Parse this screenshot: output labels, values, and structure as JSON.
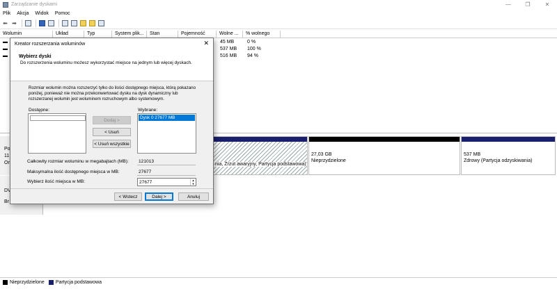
{
  "window": {
    "title": "Zarządzanie dyskami"
  },
  "menu": [
    "Plik",
    "Akcja",
    "Widok",
    "Pomoc"
  ],
  "volume_table": {
    "columns": [
      "Wolumin",
      "Układ",
      "Typ",
      "System plik...",
      "Stan",
      "Pojemność",
      "Wolne ...",
      "% wolnego"
    ],
    "rows": [
      {
        "free": "45 MB",
        "pct": "0 %"
      },
      {
        "free": "537 MB",
        "pct": "100 %"
      },
      {
        "free": "516 MB",
        "pct": "94 %"
      }
    ]
  },
  "disk_map": {
    "disk0_label_frag": [
      "Po",
      "11",
      "Or"
    ],
    "dvd_label_frag": [
      "DV",
      "Br"
    ],
    "partitions": [
      {
        "text": "nia, Zrzut awaryjny, Partycja podstawowa)"
      },
      {
        "size": "27,03 GB",
        "status": "Nieprzydzielone"
      },
      {
        "size": "537 MB",
        "status": "Zdrowy (Partycja odzyskiwania)"
      }
    ]
  },
  "legend": [
    {
      "label": "Nieprzydzielone",
      "color": "#000000"
    },
    {
      "label": "Partycja podstawowa",
      "color": "#1a1f6b"
    }
  ],
  "wizard": {
    "title": "Kreator rozszerzania woluminów",
    "heading": "Wybierz dyski",
    "subheading": "Do rozszerzenia woluminu możesz wykorzystać miejsce na jednym lub więcej dyskach.",
    "info": "Rozmiar wolumin można rozszerzyć tylko do ilości dostępnego miejsca, którą pokazano poniżej, ponieważ nie można przekonwertować dysku na dysk dynamiczny lub rozszerzanej wolumin jest woluminem rozruchowym albo systemowym.",
    "available_label": "Dostępne:",
    "selected_label": "Wybrane:",
    "selected_item": "Dysk 0     27677 MB",
    "add_button": "Dodaj >",
    "remove_button": "< Usuń",
    "remove_all_button": "< Usuń wszystkie",
    "total_label": "Całkowity rozmiar woluminu w megabajtach (MB):",
    "total_value": "121013",
    "max_label": "Maksymalna ilość dostępnego miejsca w MB:",
    "max_value": "27677",
    "choose_label": "Wybierz ilość miejsca w MB:",
    "choose_value": "27677",
    "back_button": "< Wstecz",
    "next_button": "Dalej >",
    "cancel_button": "Anuluj"
  }
}
